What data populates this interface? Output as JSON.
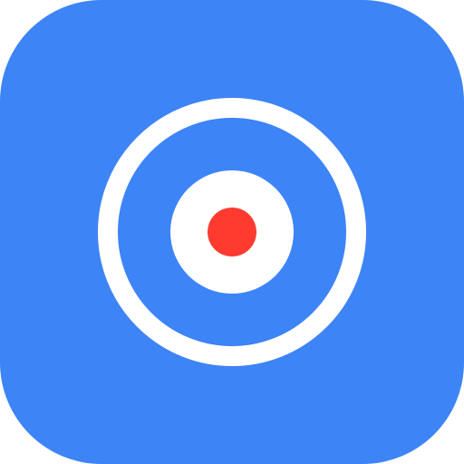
{
  "app_icon": {
    "glyph": "target-icon",
    "colors": {
      "background": "#3d84f6",
      "rings": "#ffffff",
      "center": "#ff3b30"
    }
  }
}
